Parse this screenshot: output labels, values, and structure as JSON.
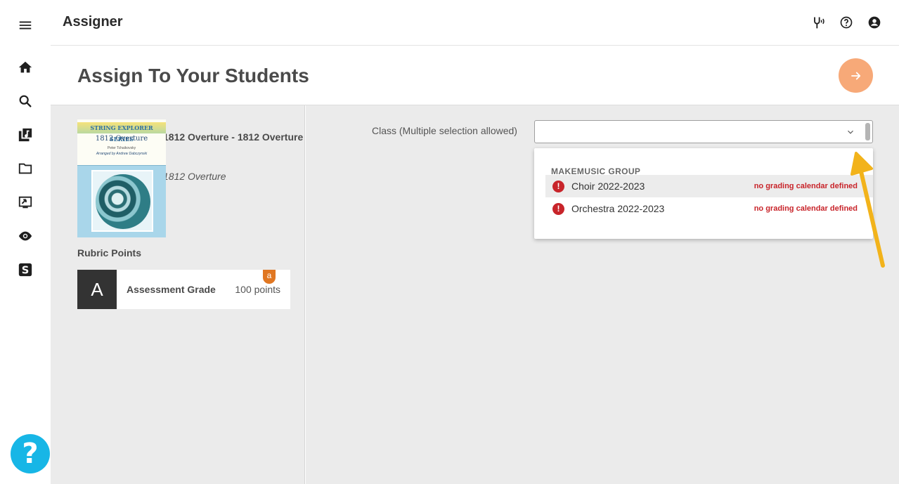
{
  "app": {
    "title": "Assigner"
  },
  "header": {
    "title": "Assign To Your Students"
  },
  "piece": {
    "cover": {
      "banner": "STRING EXPLORER SERIES",
      "name": "1812 Overture",
      "composer": "Peter Tchaikovsky",
      "arranger": "Arranged by Andrew Dabczynski"
    },
    "title": "1812 Overture - 1812 Overture",
    "subtitle": "1812 Overture"
  },
  "rubric": {
    "label": "Rubric Points",
    "letter": "A",
    "name": "Assessment Grade",
    "points": "100 points",
    "badge": "a"
  },
  "class_field": {
    "label": "Class (Multiple selection allowed)",
    "value": ""
  },
  "dropdown": {
    "group": "MAKEMUSIC GROUP",
    "options": [
      {
        "label": "Choir 2022-2023",
        "warning": "no grading calendar defined"
      },
      {
        "label": "Orchestra 2022-2023",
        "warning": "no grading calendar defined"
      }
    ]
  },
  "icons": {
    "menu": "hamburger-icon",
    "home": "home-icon",
    "search": "search-icon",
    "library": "music-library-icon",
    "folder": "folder-icon",
    "assign": "assign-icon",
    "view": "eye-icon",
    "smartmusic": "smartmusic-s-icon",
    "tuner": "tuning-fork-icon",
    "help": "help-circle-icon",
    "account": "account-icon",
    "next": "arrow-right-icon"
  },
  "colors": {
    "next_fab": "#f7a978",
    "help_fab": "#17b6e6",
    "error": "#c8242a",
    "badge": "#e07722",
    "annotation": "#f2b31b"
  }
}
